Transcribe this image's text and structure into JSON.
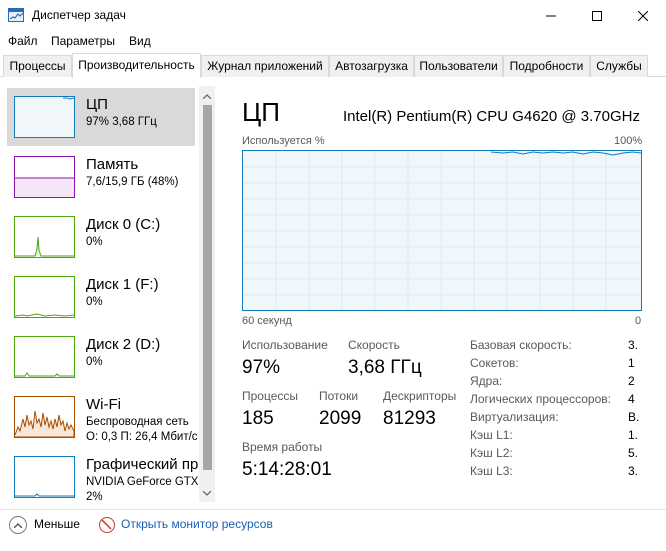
{
  "window": {
    "title": "Диспетчер задач"
  },
  "menu": [
    "Файл",
    "Параметры",
    "Вид"
  ],
  "tabs": [
    "Процессы",
    "Производительность",
    "Журнал приложений",
    "Автозагрузка",
    "Пользователи",
    "Подробности",
    "Службы"
  ],
  "active_tab": "Производительность",
  "resources": [
    {
      "name": "ЦП",
      "sub": "97% 3,68 ГГц",
      "selected": true,
      "color": "#117dbb"
    },
    {
      "name": "Память",
      "sub": "7,6/15,9 ГБ (48%)",
      "color": "#8b12ae"
    },
    {
      "name": "Диск 0 (C:)",
      "sub": "0%",
      "color": "#4da60c"
    },
    {
      "name": "Диск 1 (F:)",
      "sub": "0%",
      "color": "#4da60c"
    },
    {
      "name": "Диск 2 (D:)",
      "sub": "0%",
      "color": "#4da60c"
    },
    {
      "name": "Wi-Fi",
      "sub": "Беспроводная сеть",
      "sub2": "О: 0,3  П: 26,4 Мбит/с",
      "color": "#a74f01"
    },
    {
      "name": "Графический пр",
      "sub": "NVIDIA GeForce GTX",
      "sub2": "2%",
      "color": "#117dbb"
    }
  ],
  "detail": {
    "title": "ЦП",
    "model": "Intel(R) Pentium(R) CPU G4620 @ 3.70GHz",
    "graph_label_left": "Используется %",
    "graph_label_right": "100%",
    "axis_left": "60 секунд",
    "axis_right": "0",
    "utilization_percent": 97
  },
  "stats": {
    "utilization_label": "Использование",
    "utilization_value": "97%",
    "speed_label": "Скорость",
    "speed_value": "3,68 ГГц",
    "processes_label": "Процессы",
    "processes_value": "185",
    "threads_label": "Потоки",
    "threads_value": "2099",
    "handles_label": "Дескрипторы",
    "handles_value": "81293",
    "uptime_label": "Время работы",
    "uptime_value": "5:14:28:01"
  },
  "specs": [
    {
      "label": "Базовая скорость:",
      "value": "3."
    },
    {
      "label": "Сокетов:",
      "value": "1"
    },
    {
      "label": "Ядра:",
      "value": "2"
    },
    {
      "label": "Логических процессоров:",
      "value": "4"
    },
    {
      "label": "Виртуализация:",
      "value": "В."
    },
    {
      "label": "Кэш L1:",
      "value": "1."
    },
    {
      "label": "Кэш L2:",
      "value": "5."
    },
    {
      "label": "Кэш L3:",
      "value": "3."
    }
  ],
  "footer": {
    "fewer_details": "Меньше",
    "open_resmon": "Открыть монитор ресурсов"
  },
  "colors": {
    "accent": "#117dbb",
    "selection": "#d9d9d9",
    "link": "#1a5fb4"
  }
}
